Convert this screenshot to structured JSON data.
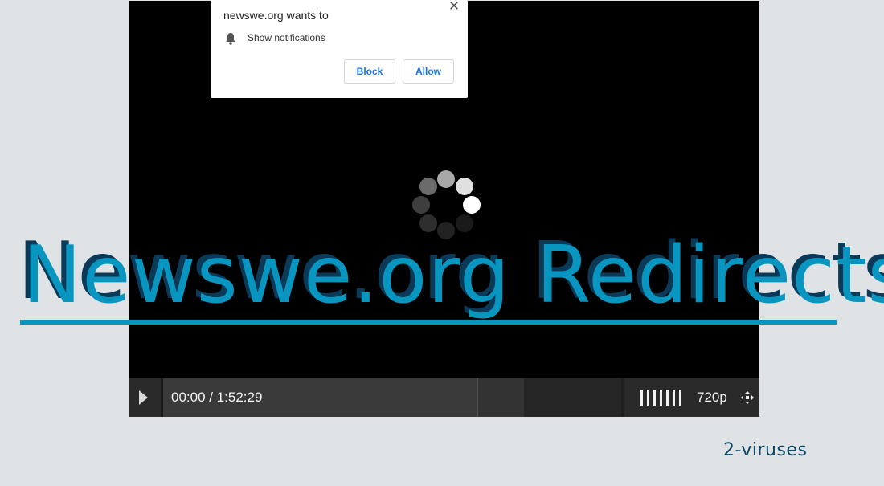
{
  "popup": {
    "title": "newswe.org wants to",
    "permission_label": "Show notifications",
    "block_label": "Block",
    "allow_label": "Allow",
    "close_glyph": "✕",
    "icons": [
      "bell-icon",
      "close-icon"
    ]
  },
  "player": {
    "time": "00:00 / 1:52:29",
    "quality": "720p",
    "progress_fraction": 0.0,
    "icons": [
      "play-icon",
      "volume-bars-icon",
      "fullscreen-icon",
      "loading-spinner-icon"
    ]
  },
  "headline": "Newswe.org Redirects",
  "watermark": "2-viruses",
  "colors": {
    "headline": "#0896c0",
    "headline_shadow": "#0a3a57",
    "page_background": "#dfe3e5",
    "video_background": "#000000",
    "button_text": "#1a73e8"
  }
}
